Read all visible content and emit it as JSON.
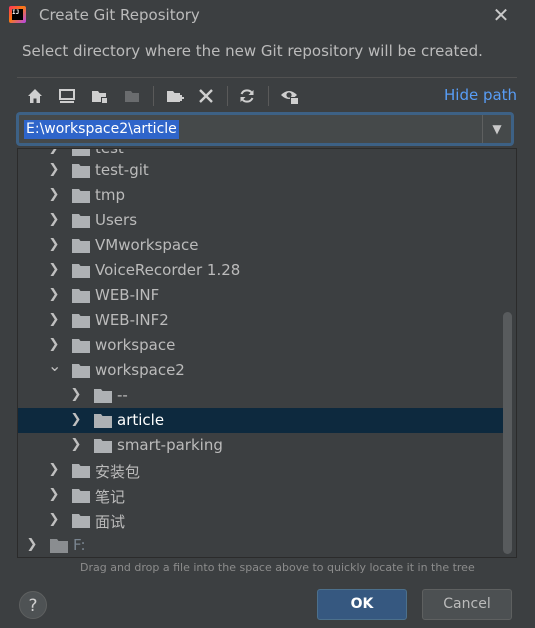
{
  "window": {
    "title": "Create Git Repository",
    "icon_text": "IJ"
  },
  "description": "Select directory where the new Git repository will be created.",
  "toolbar": {
    "buttons": [
      "home-icon",
      "desktop-icon",
      "project-folder-icon",
      "module-folder-icon",
      "new-folder-icon",
      "delete-icon",
      "refresh-icon",
      "show-hidden-icon"
    ],
    "hide_path_label": "Hide path"
  },
  "path_field": {
    "value": "E:\\workspace2\\article"
  },
  "tree": {
    "partial_top_label": "test",
    "items": [
      {
        "label": "test-git",
        "expanded": false
      },
      {
        "label": "tmp",
        "expanded": false
      },
      {
        "label": "Users",
        "expanded": false
      },
      {
        "label": "VMworkspace",
        "expanded": false
      },
      {
        "label": "VoiceRecorder 1.28",
        "expanded": false
      },
      {
        "label": "WEB-INF",
        "expanded": false
      },
      {
        "label": "WEB-INF2",
        "expanded": false
      },
      {
        "label": "workspace",
        "expanded": false
      },
      {
        "label": "workspace2",
        "expanded": true
      },
      {
        "label": "--",
        "expanded": false
      },
      {
        "label": "article",
        "expanded": false,
        "selected": true
      },
      {
        "label": "smart-parking",
        "expanded": false
      },
      {
        "label": "安装包",
        "expanded": false
      },
      {
        "label": "笔记",
        "expanded": false
      },
      {
        "label": "面试",
        "expanded": false
      },
      {
        "label": "F:",
        "expanded": false,
        "drive": true
      }
    ]
  },
  "hint": "Drag and drop a file into the space above to quickly locate it in the tree",
  "buttons": {
    "help": "?",
    "ok": "OK",
    "cancel": "Cancel"
  },
  "colors": {
    "background": "#3c3f41",
    "selection": "#0d293e",
    "accent_link": "#589df6",
    "ok_button": "#365880"
  }
}
